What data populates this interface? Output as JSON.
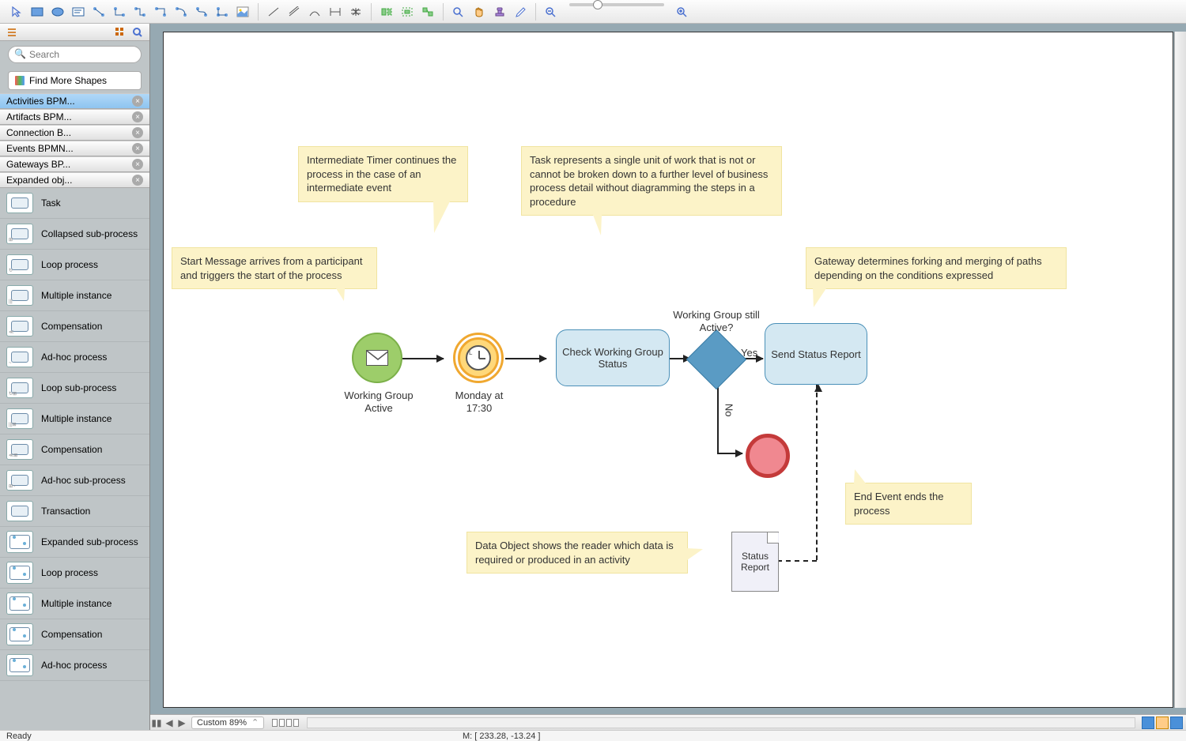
{
  "toolbar": {
    "icons_group1": [
      "pointer",
      "rect",
      "ellipse",
      "text-box",
      "connector-1",
      "connector-2",
      "connector-3",
      "connector-4",
      "connector-5",
      "connector-6",
      "connector-7",
      "image"
    ],
    "icons_group2": [
      "line-1",
      "line-2",
      "line-3",
      "line-4",
      "line-5"
    ],
    "icons_group3": [
      "align-1",
      "align-2",
      "align-3"
    ],
    "icons_group4": [
      "zoom-1",
      "hand",
      "stamp",
      "eyedropper"
    ],
    "icons_group5": [
      "zoom-out",
      "slider",
      "zoom-in"
    ]
  },
  "sidebar": {
    "search_placeholder": "Search",
    "find_more": "Find More Shapes",
    "libraries": [
      {
        "label": "Activities BPM...",
        "active": true
      },
      {
        "label": "Artifacts BPM..."
      },
      {
        "label": "Connection B..."
      },
      {
        "label": "Events BPMN..."
      },
      {
        "label": "Gateways BP..."
      },
      {
        "label": "Expanded obj..."
      }
    ],
    "shapes": [
      {
        "label": "Task",
        "badge": ""
      },
      {
        "label": "Collapsed sub-process",
        "badge": "⊞"
      },
      {
        "label": "Loop process",
        "badge": "↻"
      },
      {
        "label": "Multiple instance",
        "badge": "|||"
      },
      {
        "label": "Compensation",
        "badge": "≪"
      },
      {
        "label": "Ad-hoc process",
        "badge": "~"
      },
      {
        "label": "Loop sub-process",
        "badge": "↻⊞"
      },
      {
        "label": "Multiple instance",
        "badge": "|||⊞"
      },
      {
        "label": "Compensation",
        "badge": "≪⊞"
      },
      {
        "label": "Ad-hoc sub-process",
        "badge": "⊞~"
      },
      {
        "label": "Transaction",
        "badge": ""
      },
      {
        "label": "Expanded sub-process",
        "badge": "",
        "expanded": true
      },
      {
        "label": "Loop process",
        "badge": "",
        "expanded": true
      },
      {
        "label": "Multiple instance",
        "badge": "",
        "expanded": true
      },
      {
        "label": "Compensation",
        "badge": "",
        "expanded": true
      },
      {
        "label": "Ad-hoc process",
        "badge": "",
        "expanded": true
      }
    ]
  },
  "diagram": {
    "annotations": {
      "start_msg": "Start Message arrives from a participant and triggers the start of the process",
      "timer": "Intermediate Timer continues the process in the case of an intermediate event",
      "task": "Task represents a single unit of work that is not or cannot be broken down to a further level of business process detail without diagramming the steps in a procedure",
      "gateway": "Gateway determines forking and merging of paths depending on the conditions expressed",
      "data_obj": "Data Object shows the reader which data is required or produced in an activity",
      "end": "End Event ends the process"
    },
    "start_label": "Working Group Active",
    "timer_label": "Monday at 17:30",
    "task1_label": "Check Working Group Status",
    "gateway_label": "Working Group still Active?",
    "yes": "Yes",
    "no": "No",
    "task2_label": "Send Status Report",
    "data_label": "Status Report"
  },
  "bottombar": {
    "zoom_label": "Custom 89%"
  },
  "status_bar": {
    "ready": "Ready",
    "mouse": "M: [ 233.28, -13.24 ]"
  }
}
